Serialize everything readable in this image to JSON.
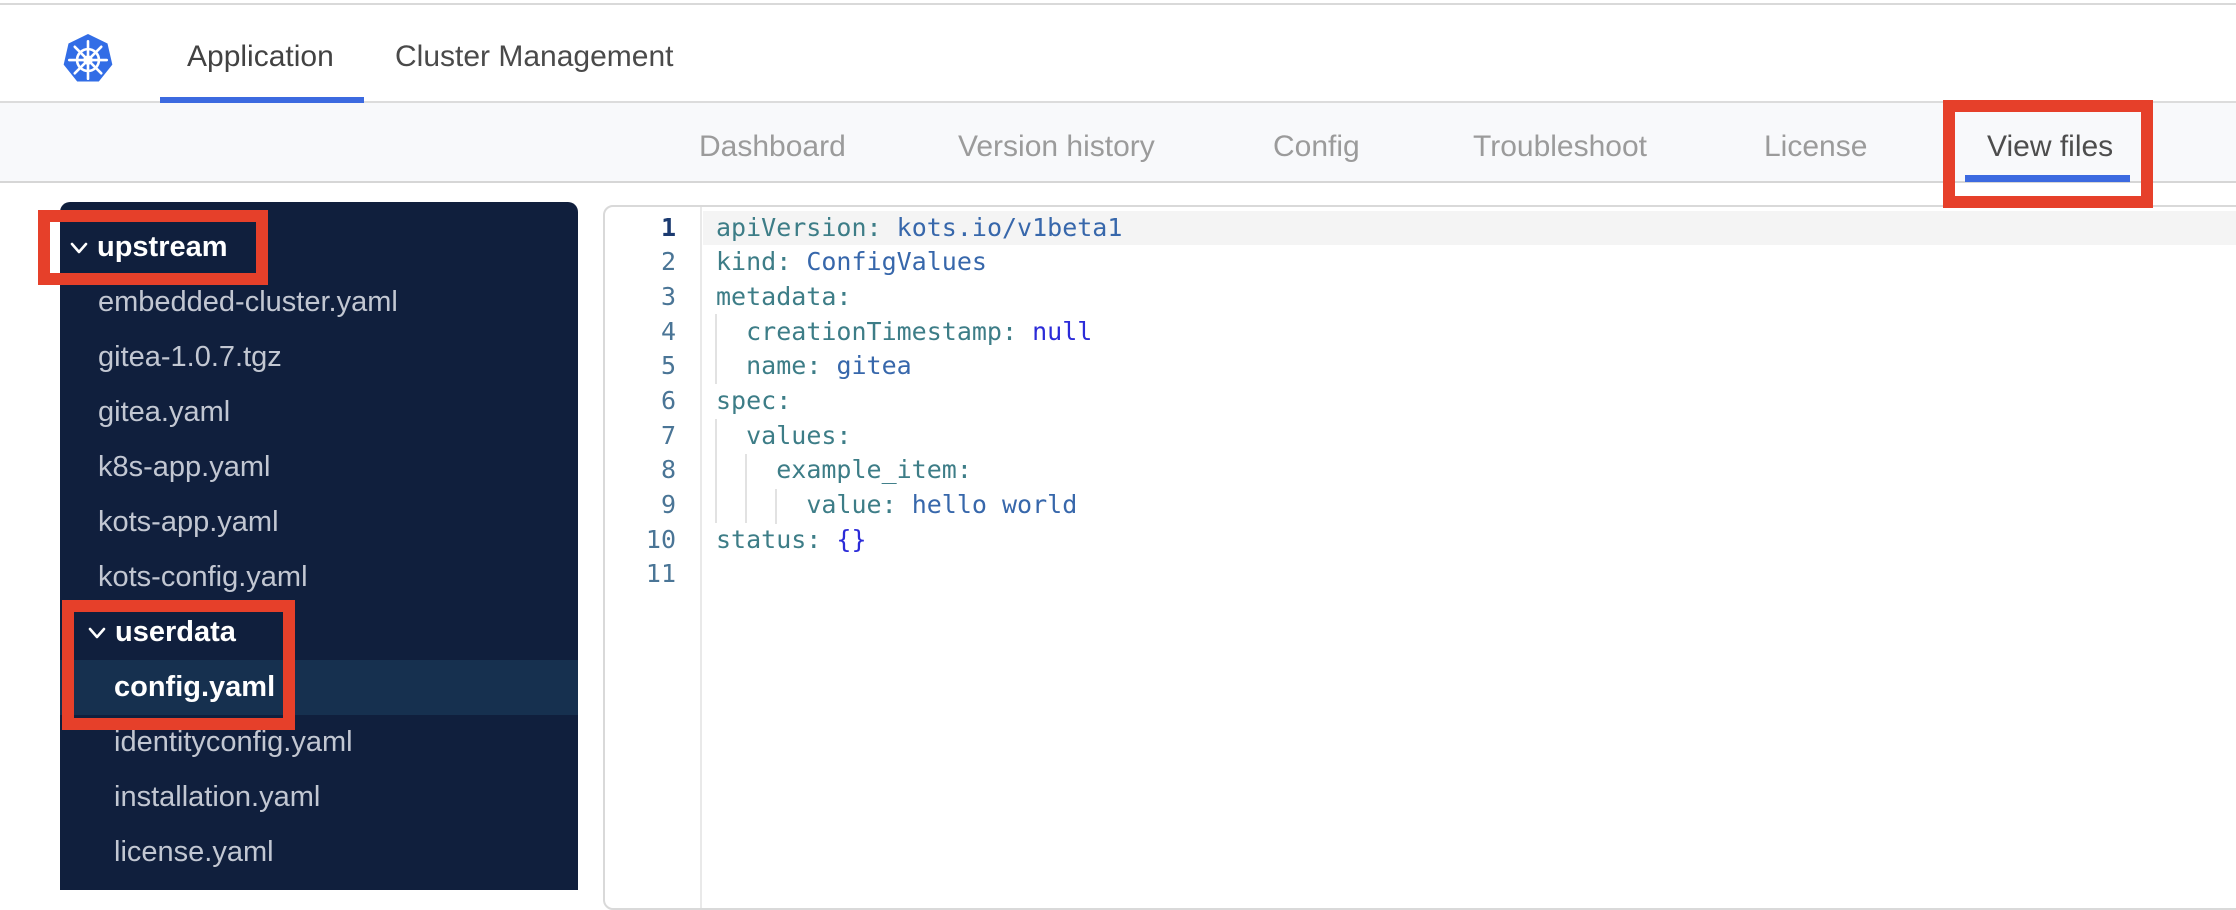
{
  "header": {
    "tabs": [
      {
        "label": "Application",
        "active": true
      },
      {
        "label": "Cluster Management",
        "active": false
      }
    ]
  },
  "nav": {
    "tabs": [
      {
        "label": "Dashboard",
        "active": false
      },
      {
        "label": "Version history",
        "active": false
      },
      {
        "label": "Config",
        "active": false
      },
      {
        "label": "Troubleshoot",
        "active": false
      },
      {
        "label": "License",
        "active": false
      },
      {
        "label": "View files",
        "active": true
      }
    ]
  },
  "file_tree": {
    "items": [
      {
        "label": "upstream",
        "type": "folder",
        "level": 0,
        "expanded": true,
        "annotated": true
      },
      {
        "label": "embedded-cluster.yaml",
        "type": "file",
        "level": 1
      },
      {
        "label": "gitea-1.0.7.tgz",
        "type": "file",
        "level": 1
      },
      {
        "label": "gitea.yaml",
        "type": "file",
        "level": 1
      },
      {
        "label": "k8s-app.yaml",
        "type": "file",
        "level": 1
      },
      {
        "label": "kots-app.yaml",
        "type": "file",
        "level": 1
      },
      {
        "label": "kots-config.yaml",
        "type": "file",
        "level": 1
      },
      {
        "label": "userdata",
        "type": "folder",
        "level": 1,
        "expanded": true,
        "annotated": true
      },
      {
        "label": "config.yaml",
        "type": "file",
        "level": 2,
        "selected": true,
        "annotated": true
      },
      {
        "label": "identityconfig.yaml",
        "type": "file",
        "level": 2
      },
      {
        "label": "installation.yaml",
        "type": "file",
        "level": 2
      },
      {
        "label": "license.yaml",
        "type": "file",
        "level": 2
      }
    ]
  },
  "editor": {
    "language": "yaml",
    "lines": [
      {
        "num": 1,
        "active": true,
        "segments": [
          {
            "text": "apiVersion:",
            "cls": "key"
          },
          {
            "text": " "
          },
          {
            "text": "kots.io/v1beta1",
            "cls": "str"
          }
        ]
      },
      {
        "num": 2,
        "segments": [
          {
            "text": "kind:",
            "cls": "key"
          },
          {
            "text": " "
          },
          {
            "text": "ConfigValues",
            "cls": "str"
          }
        ]
      },
      {
        "num": 3,
        "segments": [
          {
            "text": "metadata:",
            "cls": "key"
          }
        ]
      },
      {
        "num": 4,
        "segments": [
          {
            "text": "  "
          },
          {
            "text": "creationTimestamp:",
            "cls": "key"
          },
          {
            "text": " "
          },
          {
            "text": "null",
            "cls": "const"
          }
        ]
      },
      {
        "num": 5,
        "segments": [
          {
            "text": "  "
          },
          {
            "text": "name:",
            "cls": "key"
          },
          {
            "text": " "
          },
          {
            "text": "gitea",
            "cls": "str"
          }
        ]
      },
      {
        "num": 6,
        "segments": [
          {
            "text": "spec:",
            "cls": "key"
          }
        ]
      },
      {
        "num": 7,
        "segments": [
          {
            "text": "  "
          },
          {
            "text": "values:",
            "cls": "key"
          }
        ]
      },
      {
        "num": 8,
        "segments": [
          {
            "text": "    "
          },
          {
            "text": "example_item:",
            "cls": "key"
          }
        ]
      },
      {
        "num": 9,
        "segments": [
          {
            "text": "      "
          },
          {
            "text": "value:",
            "cls": "key"
          },
          {
            "text": " "
          },
          {
            "text": "hello world",
            "cls": "str"
          }
        ]
      },
      {
        "num": 10,
        "segments": [
          {
            "text": "status:",
            "cls": "key"
          },
          {
            "text": " "
          },
          {
            "text": "{}",
            "cls": "const"
          }
        ]
      },
      {
        "num": 11,
        "segments": []
      }
    ]
  },
  "annotations": [
    {
      "target": "upstream-folder"
    },
    {
      "target": "userdata-config-yaml"
    },
    {
      "target": "view-files-tab"
    }
  ],
  "colors": {
    "annotation_red": "#e6402a",
    "accent_blue": "#3c6ae0",
    "logo_blue": "#326de6",
    "sidebar_bg": "#101f3d",
    "selected_row_bg": "#16304f",
    "yaml_key": "#3d7d87",
    "yaml_string": "#3767ab",
    "yaml_constant": "#2b2bd8"
  }
}
